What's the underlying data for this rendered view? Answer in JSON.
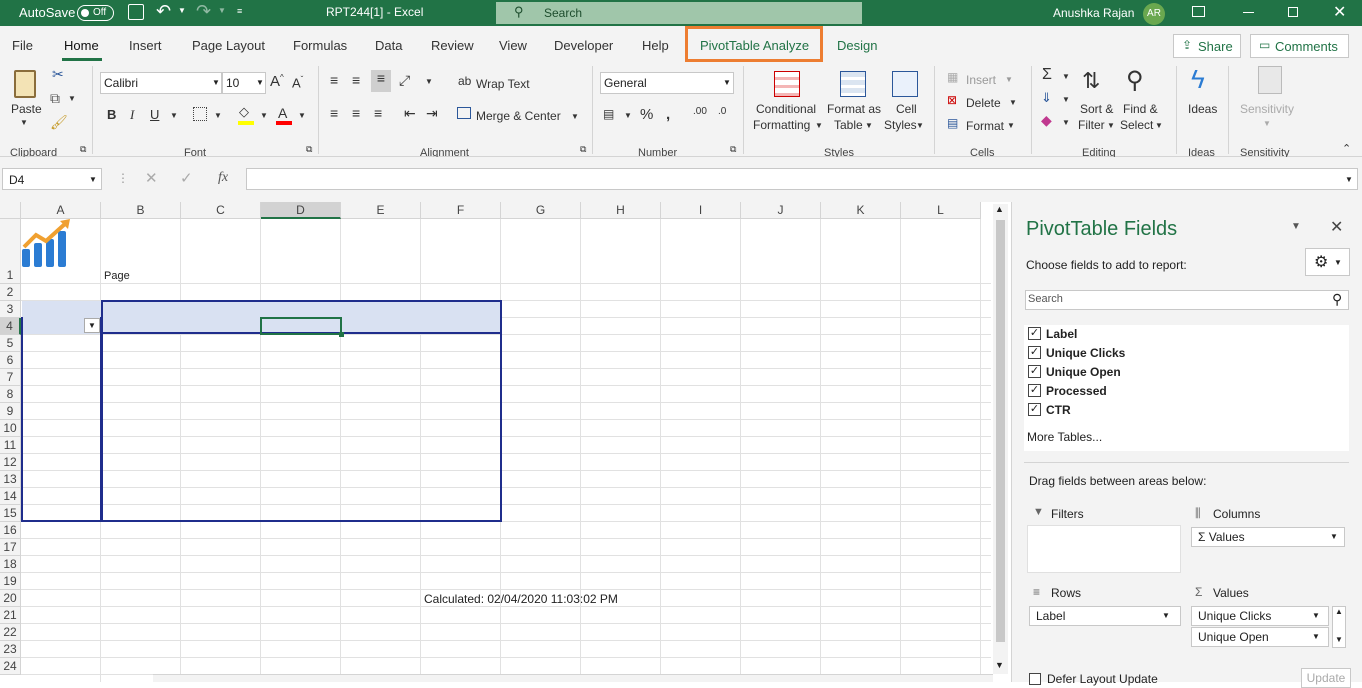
{
  "titlebar": {
    "autosave_label": "AutoSave",
    "autosave_state": "Off",
    "doc_title": "RPT244[1]  -  Excel",
    "search_placeholder": "Search",
    "user_name": "Anushka Rajan",
    "user_initials": "AR"
  },
  "tabs": [
    "File",
    "Home",
    "Insert",
    "Page Layout",
    "Formulas",
    "Data",
    "Review",
    "View",
    "Developer",
    "Help",
    "PivotTable Analyze",
    "Design"
  ],
  "active_tab": "Home",
  "share_label": "Share",
  "comments_label": "Comments",
  "ribbon": {
    "paste_label": "Paste",
    "clipboard_label": "Clipboard",
    "font_name": "Calibri",
    "font_size": "10",
    "font_label": "Font",
    "wrap_text": "Wrap Text",
    "merge_center": "Merge & Center",
    "alignment_label": "Alignment",
    "number_format": "General",
    "number_label": "Number",
    "cond_fmt_1": "Conditional",
    "cond_fmt_2": "Formatting",
    "fmt_table_1": "Format as",
    "fmt_table_2": "Table",
    "cell_styles_1": "Cell",
    "cell_styles_2": "Styles",
    "styles_label": "Styles",
    "insert_label": "Insert",
    "delete_label": "Delete",
    "format_label": "Format",
    "cells_label": "Cells",
    "sort_1": "Sort &",
    "sort_2": "Filter",
    "find_1": "Find &",
    "find_2": "Select",
    "editing_label": "Editing",
    "ideas_btn": "Ideas",
    "ideas_label": "Ideas",
    "sensitivity_btn": "Sensitivity",
    "sensitivity_label": "Sensitivity"
  },
  "formula_bar": {
    "name_box": "D4",
    "fx": "fx",
    "value": ""
  },
  "columns": [
    "A",
    "B",
    "C",
    "D",
    "E",
    "F",
    "G",
    "H",
    "I",
    "J",
    "K",
    "L"
  ],
  "rows": [
    "1",
    "2",
    "3",
    "4",
    "5",
    "6",
    "7",
    "8",
    "9",
    "10",
    "11",
    "12",
    "13",
    "14",
    "15",
    "16",
    "17",
    "18",
    "19",
    "20",
    "21",
    "22",
    "23",
    "24"
  ],
  "cells": {
    "B1": "Page",
    "F20": "Calculated: 02/04/2020 11:03:02 PM"
  },
  "pivot_panel": {
    "title": "PivotTable Fields",
    "subtitle": "Choose fields to add to report:",
    "search_placeholder": "Search",
    "fields": [
      {
        "label": "Label",
        "checked": true
      },
      {
        "label": "Unique Clicks",
        "checked": true
      },
      {
        "label": "Unique Open",
        "checked": true
      },
      {
        "label": "Processed",
        "checked": true
      },
      {
        "label": "CTR",
        "checked": true
      }
    ],
    "more_tables": "More Tables...",
    "drag_text": "Drag fields between areas below:",
    "filters_label": "Filters",
    "columns_label": "Columns",
    "columns_item": "Values",
    "rows_label": "Rows",
    "rows_item": "Label",
    "values_label": "Values",
    "values_items": [
      "Unique Clicks",
      "Unique Open"
    ],
    "defer_label": "Defer Layout Update",
    "update_label": "Update"
  },
  "colors": {
    "excel_green": "#217346",
    "highlight_orange": "#ed7d31",
    "pivot_border": "#1f2d8c",
    "pivot_fill": "#d9e1f2"
  }
}
